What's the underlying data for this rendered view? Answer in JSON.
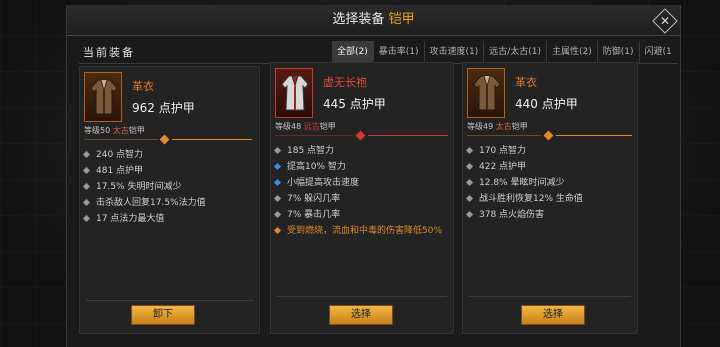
{
  "header": {
    "title_prefix": "选择装备",
    "title_accent": "铠甲"
  },
  "left": {
    "section_title": "当前装备"
  },
  "tabs": [
    {
      "label": "全部(2)",
      "active": true
    },
    {
      "label": "暴击率(1)",
      "active": false
    },
    {
      "label": "攻击速度(1)",
      "active": false
    },
    {
      "label": "远古/太古(1)",
      "active": false
    },
    {
      "label": "主属性(2)",
      "active": false
    },
    {
      "label": "防御(1)",
      "active": false
    },
    {
      "label": "闪避(1",
      "active": false
    }
  ],
  "cards": {
    "current": {
      "name": "革衣",
      "armor": "962 点护甲",
      "level": "等级50",
      "quality": "太古",
      "type": "铠甲",
      "stats": [
        {
          "text": "240 点智力",
          "color": "gray"
        },
        {
          "text": "481 点护甲",
          "color": "gray"
        },
        {
          "text": "17.5% 失明时间减少",
          "color": "gray"
        },
        {
          "text": "击杀敌人回复17.5%法力值",
          "color": "gray"
        },
        {
          "text": "17 点法力最大值",
          "color": "gray"
        }
      ],
      "button": "卸下"
    },
    "option1": {
      "name": "虚无长袍",
      "armor": "445 点护甲",
      "level": "等级48",
      "quality": "远古",
      "type": "铠甲",
      "stats": [
        {
          "text": "185 点智力",
          "color": "gray"
        },
        {
          "text": "提高10% 智力",
          "color": "blue"
        },
        {
          "text": "小幅提高攻击速度",
          "color": "blue"
        },
        {
          "text": "7% 躲闪几率",
          "color": "gray"
        },
        {
          "text": "7% 暴击几率",
          "color": "gray"
        },
        {
          "text": "受到燃烧，流血和中毒的伤害降低50%",
          "color": "orange"
        }
      ],
      "button": "选择"
    },
    "option2": {
      "name": "革衣",
      "armor": "440 点护甲",
      "level": "等级49",
      "quality": "太古",
      "type": "铠甲",
      "stats": [
        {
          "text": "170 点智力",
          "color": "gray"
        },
        {
          "text": "422 点护甲",
          "color": "gray"
        },
        {
          "text": "12.8% 晕眩时间减少",
          "color": "gray"
        },
        {
          "text": "战斗胜利恢复12% 生命值",
          "color": "gray"
        },
        {
          "text": "378 点火焰伤害",
          "color": "gray"
        }
      ],
      "button": "选择"
    }
  },
  "colors": {
    "accent": "#f0a21c",
    "orange_quality": "#e07a2a",
    "red_quality": "#e24a3a",
    "blue_bullet": "#3a8ed8"
  }
}
